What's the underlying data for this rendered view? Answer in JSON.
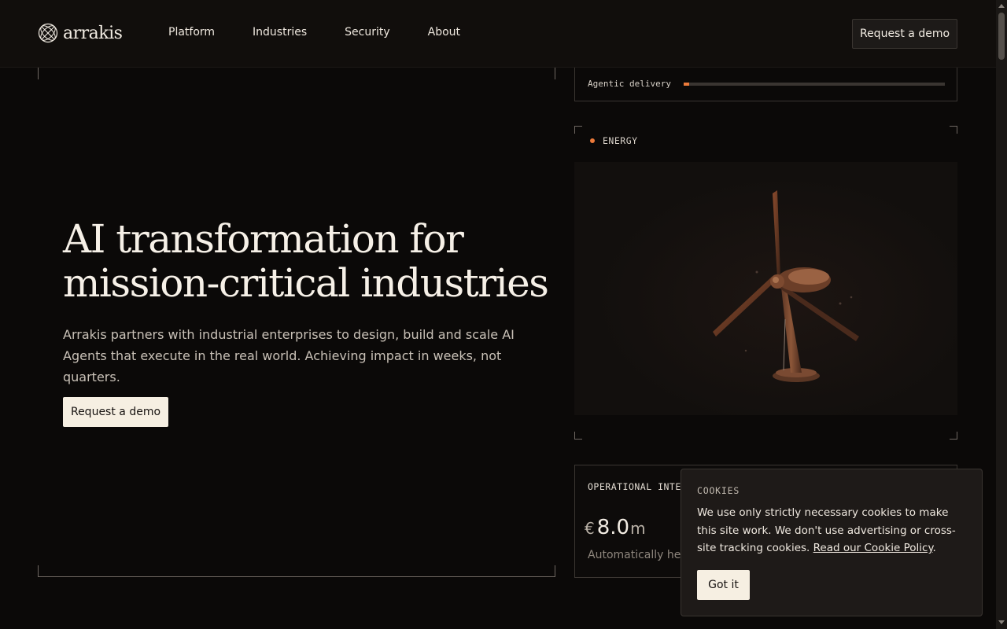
{
  "brand": {
    "name": "arrakis",
    "logo_icon": "globe-lattice-icon"
  },
  "nav": {
    "items": [
      {
        "label": "Platform"
      },
      {
        "label": "Industries"
      },
      {
        "label": "Security"
      },
      {
        "label": "About"
      }
    ],
    "cta_label": "Request a demo"
  },
  "hero": {
    "title_line1": "AI transformation for",
    "title_line2": "mission-critical industries",
    "subtitle": "Arrakis partners with industrial enterprises to design, build and scale AI Agents that execute in the real world. Achieving impact in weeks, not quarters.",
    "cta_label": "Request a demo"
  },
  "agentic": {
    "label": "Agentic delivery",
    "progress_percent": 2,
    "accent_color": "#ec7a3a"
  },
  "energy": {
    "label": "ENERGY",
    "image_subject": "wind-turbine-icon"
  },
  "ops": {
    "label": "OPERATIONAL INTEL",
    "currency": "€",
    "value": "8.0",
    "unit": "m",
    "description": "Automatically hed"
  },
  "cookies": {
    "title": "COOKIES",
    "text": "We use only strictly necessary cookies to make this site work. We don't use advertising or cross-site tracking cookies. ",
    "link_label": "Read our Cookie Policy",
    "link_suffix": ".",
    "button_label": "Got it"
  }
}
